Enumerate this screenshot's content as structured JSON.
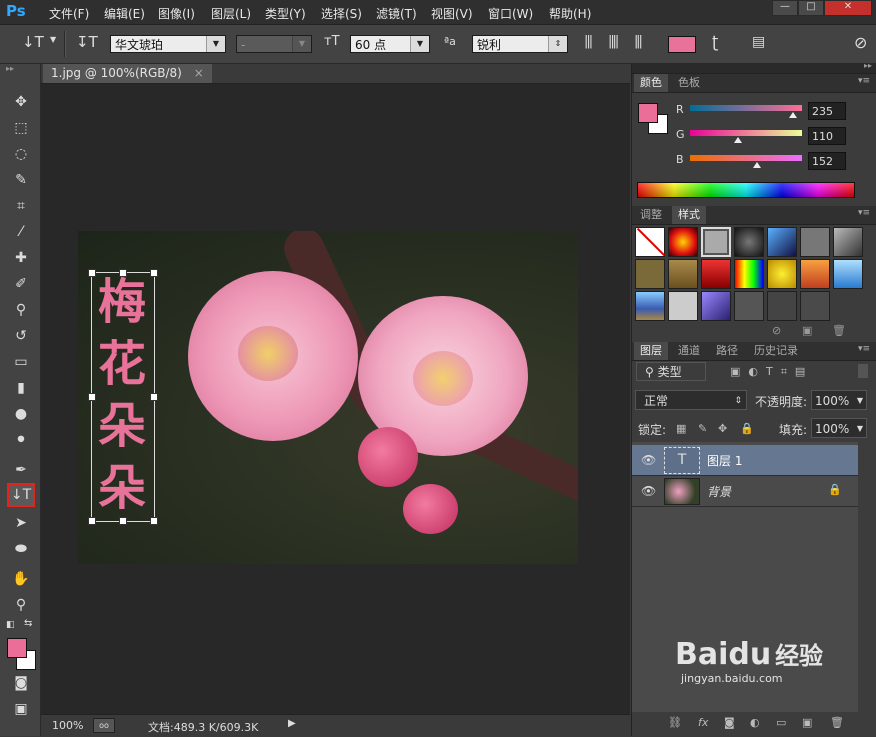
{
  "app": {
    "logo": "Ps"
  },
  "menubar": {
    "items": [
      "文件(F)",
      "编辑(E)",
      "图像(I)",
      "图层(L)",
      "类型(Y)",
      "选择(S)",
      "滤镜(T)",
      "视图(V)",
      "窗口(W)",
      "帮助(H)"
    ],
    "window_controls": [
      "—",
      "□",
      "✕"
    ]
  },
  "options_bar": {
    "tool_icon": "vertical-type-icon",
    "font_family": "华文琥珀",
    "font_style": "-",
    "font_size": "60 点",
    "aa_label": "ªa",
    "antialias": "锐利",
    "text_color": "#e8729a"
  },
  "document": {
    "tab_title": "1.jpg @ 100%(RGB/8)",
    "tab_close": "×",
    "vertical_text": [
      "梅",
      "花",
      "朵",
      "朵"
    ],
    "text_color": "#e8729a"
  },
  "statusbar": {
    "zoom": "100%",
    "doc_info": "文档:489.3 K/609.3K"
  },
  "color_panel": {
    "tabs": [
      "颜色",
      "色板"
    ],
    "channels": [
      {
        "label": "R",
        "value": "235",
        "fraction": 0.92
      },
      {
        "label": "G",
        "value": "110",
        "fraction": 0.43
      },
      {
        "label": "B",
        "value": "152",
        "fraction": 0.6
      }
    ],
    "foreground": "#eb6e98",
    "background": "#ffffff"
  },
  "styles_panel": {
    "tabs": [
      "调整",
      "样式"
    ],
    "active_tab": "样式"
  },
  "layers_panel": {
    "tabs": [
      "图层",
      "通道",
      "路径",
      "历史记录"
    ],
    "filter_label": "类型",
    "blend_mode": "正常",
    "opacity_label": "不透明度:",
    "opacity_value": "100%",
    "lock_label": "锁定:",
    "fill_label": "填充:",
    "fill_value": "100%",
    "layers": [
      {
        "name": "图层 1",
        "type": "text",
        "thumb": "T",
        "selected": true
      },
      {
        "name": "背景",
        "type": "image",
        "locked": true,
        "selected": false
      }
    ]
  },
  "watermark": {
    "brand": "Baidu",
    "brand_cn": "经验",
    "url": "jingyan.baidu.com"
  }
}
